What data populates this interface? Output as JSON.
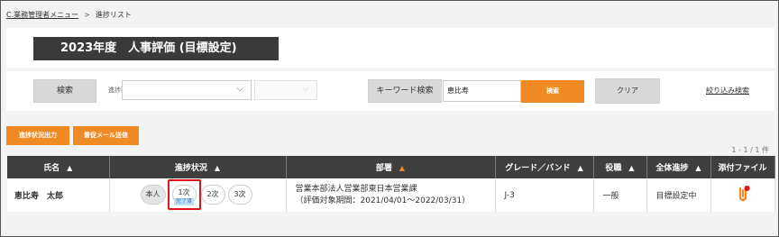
{
  "breadcrumb": {
    "items": [
      "C.業務管理者メニュー",
      "進捗リスト"
    ],
    "separator": ">"
  },
  "page_title": "2023年度　人事評価 (目標設定)",
  "search": {
    "button_label": "検索",
    "filter_label": "進捗確認",
    "filter1_value": "",
    "filter2_value": "",
    "keyword_label": "キーワード検索",
    "keyword_value": "恵比寿",
    "search_button": "検索",
    "clear_button": "クリア",
    "refine_link": "絞り込み検索"
  },
  "actions": {
    "progress_output": "進捗状況出力",
    "reminder_mail": "督促メール送信"
  },
  "pagination": "1 - 1 / 1 件",
  "table": {
    "headers": {
      "name": "氏名",
      "progress": "進捗状況",
      "dept": "部署",
      "grade": "グレード／バンド",
      "role": "役職",
      "overall": "全体進捗",
      "attach": "添付ファイル"
    },
    "sort_arrow": "▲",
    "rows": [
      {
        "name": "恵比寿　太郎",
        "steps": {
          "self": "本人",
          "first": "1次",
          "first_status": "完了済",
          "second": "2次",
          "third": "3次"
        },
        "dept_line1": "営業本部法人営業部東日本営業課",
        "dept_line2": "（評価対象期間：2021/04/01～2022/03/31）",
        "grade": "J-3",
        "role": "一般",
        "overall": "目標設定中"
      }
    ]
  },
  "colors": {
    "accent": "#f08a24",
    "header_bg": "#3f3f3f",
    "highlight": "#e0121c",
    "status_tag": "#bfe0f5"
  },
  "icons": {
    "select_chevron": "chevron-down-icon",
    "attachment": "attachment-icon"
  }
}
